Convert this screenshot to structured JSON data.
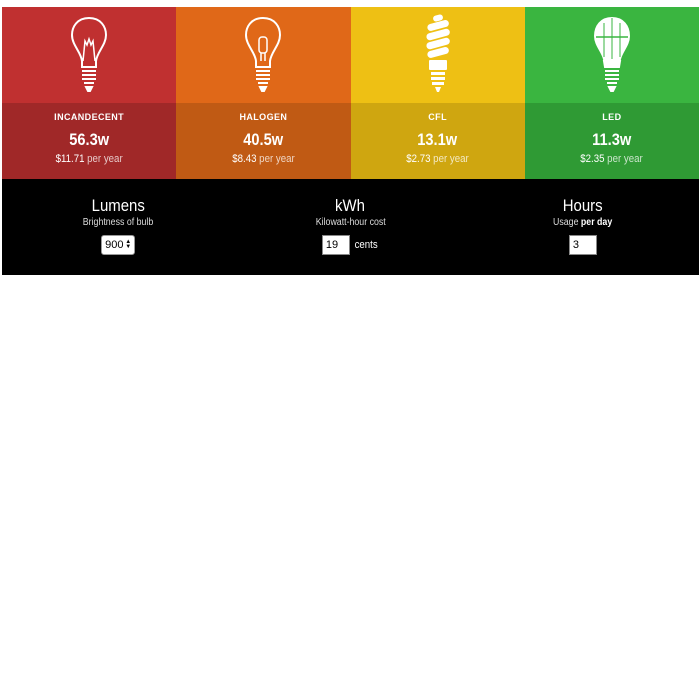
{
  "bulbs": [
    {
      "name": "INCANDECENT",
      "watts": "56.3w",
      "cost": "$11.71",
      "cost_unit": "per year",
      "icon": "incandescent-bulb-icon",
      "top_color": "#c03030",
      "bottom_color": "#a02828"
    },
    {
      "name": "HALOGEN",
      "watts": "40.5w",
      "cost": "$8.43",
      "cost_unit": "per year",
      "icon": "halogen-bulb-icon",
      "top_color": "#e06818",
      "bottom_color": "#c05a14"
    },
    {
      "name": "CFL",
      "watts": "13.1w",
      "cost": "$2.73",
      "cost_unit": "per year",
      "icon": "cfl-bulb-icon",
      "top_color": "#eec014",
      "bottom_color": "#cfa610"
    },
    {
      "name": "LED",
      "watts": "11.3w",
      "cost": "$2.35",
      "cost_unit": "per year",
      "icon": "led-bulb-icon",
      "top_color": "#3ab540",
      "bottom_color": "#2f9a34"
    }
  ],
  "controls": {
    "lumens": {
      "title": "Lumens",
      "subtitle": "Brightness of bulb",
      "value": "900"
    },
    "kwh": {
      "title": "kWh",
      "subtitle": "Kilowatt-hour cost",
      "value": "19",
      "unit": "cents"
    },
    "hours": {
      "title": "Hours",
      "subtitle_prefix": "Usage",
      "subtitle_bold": "per day",
      "value": "3"
    }
  }
}
